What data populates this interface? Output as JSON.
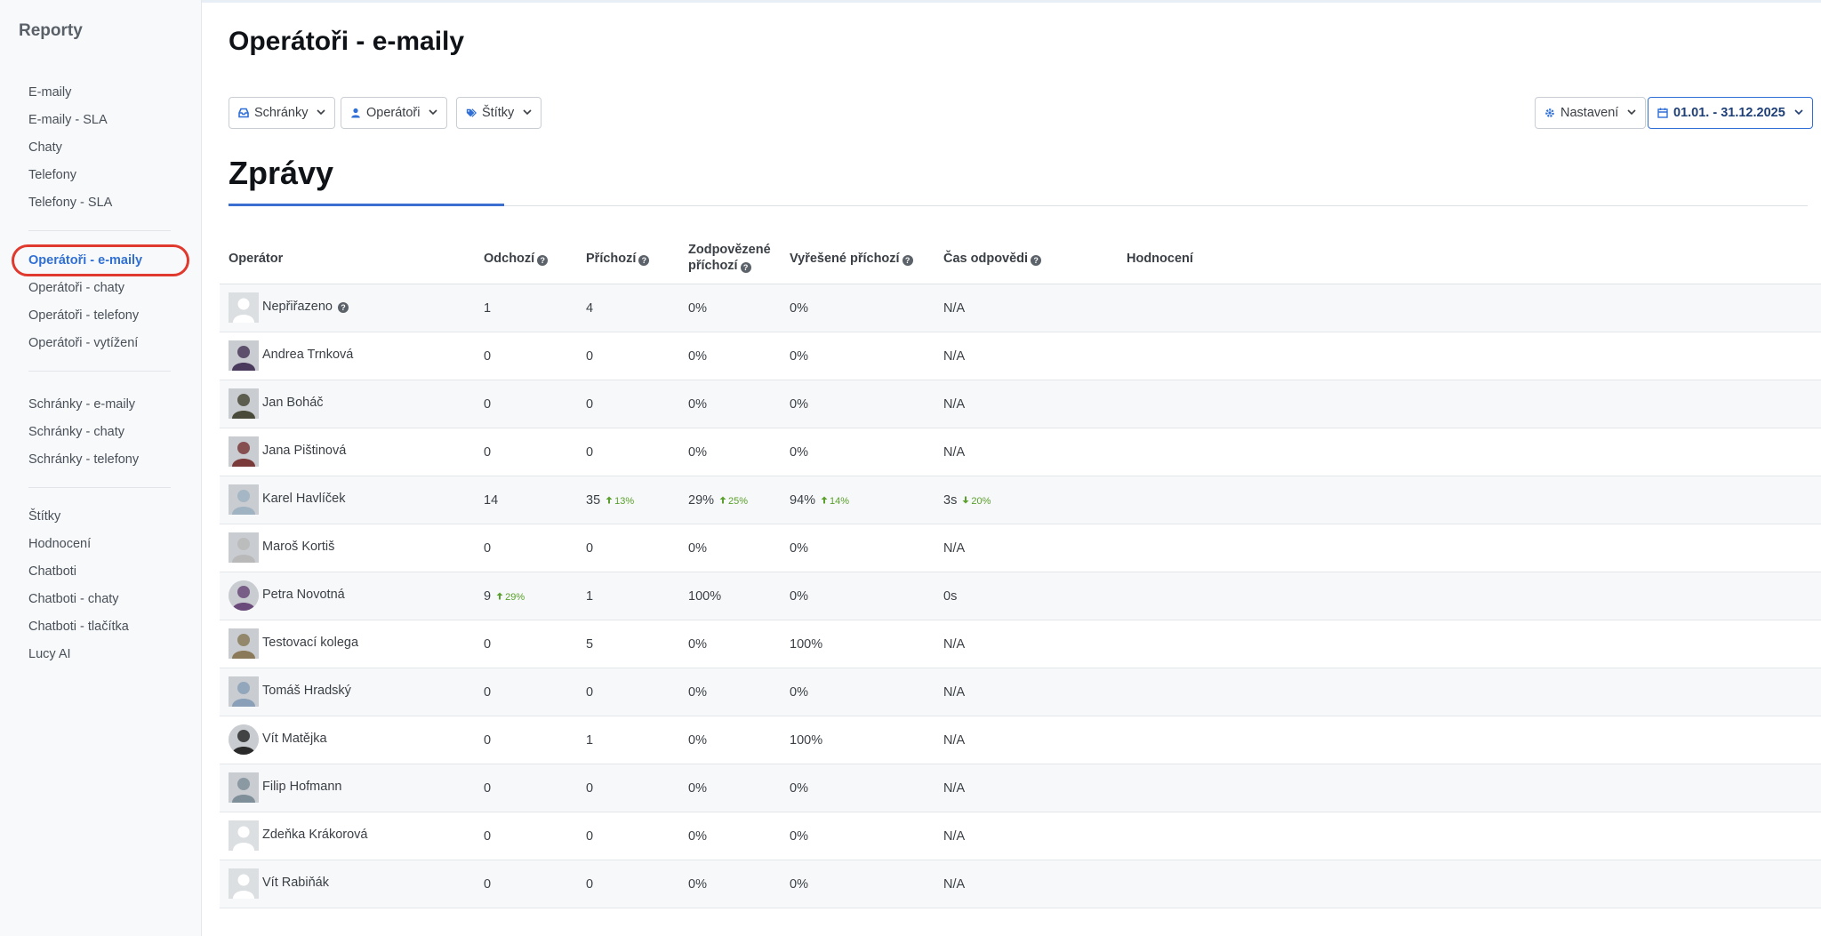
{
  "sidebar": {
    "title": "Reporty",
    "groups": [
      {
        "items": [
          {
            "label": "E-maily",
            "name": "sidebar-item-emails"
          },
          {
            "label": "E-maily - SLA",
            "name": "sidebar-item-emails-sla"
          },
          {
            "label": "Chaty",
            "name": "sidebar-item-chats"
          },
          {
            "label": "Telefony",
            "name": "sidebar-item-phones"
          },
          {
            "label": "Telefony - SLA",
            "name": "sidebar-item-phones-sla"
          }
        ]
      },
      {
        "items": [
          {
            "label": "Operátoři - e-maily",
            "name": "sidebar-item-operators-emails",
            "active": true
          },
          {
            "label": "Operátoři - chaty",
            "name": "sidebar-item-operators-chats"
          },
          {
            "label": "Operátoři - telefony",
            "name": "sidebar-item-operators-phones"
          },
          {
            "label": "Operátoři - vytížení",
            "name": "sidebar-item-operators-workload"
          }
        ]
      },
      {
        "items": [
          {
            "label": "Schránky - e-maily",
            "name": "sidebar-item-mailboxes-emails"
          },
          {
            "label": "Schránky - chaty",
            "name": "sidebar-item-mailboxes-chats"
          },
          {
            "label": "Schránky - telefony",
            "name": "sidebar-item-mailboxes-phones"
          }
        ]
      },
      {
        "items": [
          {
            "label": "Štítky",
            "name": "sidebar-item-tags"
          },
          {
            "label": "Hodnocení",
            "name": "sidebar-item-ratings"
          },
          {
            "label": "Chatboti",
            "name": "sidebar-item-chatbots"
          },
          {
            "label": "Chatboti - chaty",
            "name": "sidebar-item-chatbots-chats"
          },
          {
            "label": "Chatboti - tlačítka",
            "name": "sidebar-item-chatbots-buttons"
          },
          {
            "label": "Lucy AI",
            "name": "sidebar-item-lucy-ai"
          }
        ]
      }
    ]
  },
  "header": {
    "title": "Operátoři - e-maily"
  },
  "filters": {
    "mailboxes": "Schránky",
    "operators": "Operátoři",
    "tags": "Štítky",
    "settings": "Nastavení",
    "date_range": "01.01. - 31.12.2025"
  },
  "section": {
    "title": "Zprávy"
  },
  "table": {
    "headers": {
      "operator": "Operátor",
      "outgoing": "Odchozí",
      "incoming": "Příchozí",
      "answered_line1": "Zodpovězené",
      "answered_line2": "příchozí",
      "resolved": "Vyřešené příchozí",
      "response_time": "Čas odpovědi",
      "rating": "Hodnocení"
    },
    "rows": [
      {
        "name": "Nepřiřazeno",
        "info": true,
        "avatar": "placeholder",
        "outgoing": "1",
        "incoming": "4",
        "answered": "0%",
        "resolved": "0%",
        "response": "N/A"
      },
      {
        "name": "Andrea Trnková",
        "avatar": "photo",
        "avatar_color": "#4a3a5c",
        "outgoing": "0",
        "incoming": "0",
        "answered": "0%",
        "resolved": "0%",
        "response": "N/A"
      },
      {
        "name": "Jan Boháč",
        "avatar": "photo",
        "avatar_color": "#4a4a3a",
        "outgoing": "0",
        "incoming": "0",
        "answered": "0%",
        "resolved": "0%",
        "response": "N/A"
      },
      {
        "name": "Jana Pištinová",
        "avatar": "photo",
        "avatar_color": "#7a3a3a",
        "outgoing": "0",
        "incoming": "0",
        "answered": "0%",
        "resolved": "0%",
        "response": "N/A"
      },
      {
        "name": "Karel Havlíček",
        "avatar": "photo",
        "avatar_color": "#9fb3c2",
        "outgoing": "14",
        "incoming": "35",
        "incoming_trend": "13%",
        "answered": "29%",
        "answered_trend": "25%",
        "resolved": "94%",
        "resolved_trend": "14%",
        "response": "3s",
        "response_trend": "20%"
      },
      {
        "name": "Maroš Kortiš",
        "avatar": "photo",
        "avatar_color": "#b9b9b9",
        "outgoing": "0",
        "incoming": "0",
        "answered": "0%",
        "resolved": "0%",
        "response": "N/A"
      },
      {
        "name": "Petra Novotná",
        "avatar": "photo",
        "avatar_color": "#6a4a7a",
        "round": true,
        "outgoing": "9",
        "outgoing_trend": "29%",
        "incoming": "1",
        "answered": "100%",
        "resolved": "0%",
        "response": "0s"
      },
      {
        "name": "Testovací kolega",
        "avatar": "photo",
        "avatar_color": "#8a7a5a",
        "outgoing": "0",
        "incoming": "5",
        "answered": "0%",
        "resolved": "100%",
        "response": "N/A"
      },
      {
        "name": "Tomáš Hradský",
        "avatar": "photo",
        "avatar_color": "#8aa0b8",
        "outgoing": "0",
        "incoming": "0",
        "answered": "0%",
        "resolved": "0%",
        "response": "N/A"
      },
      {
        "name": "Vít Matějka",
        "avatar": "photo",
        "avatar_color": "#2a2a2a",
        "round": true,
        "outgoing": "0",
        "incoming": "1",
        "answered": "0%",
        "resolved": "100%",
        "response": "N/A"
      },
      {
        "name": "Filip Hofmann",
        "avatar": "photo",
        "avatar_color": "#7f8f9a",
        "outgoing": "0",
        "incoming": "0",
        "answered": "0%",
        "resolved": "0%",
        "response": "N/A"
      },
      {
        "name": "Zdeňka Krákorová",
        "avatar": "placeholder",
        "outgoing": "0",
        "incoming": "0",
        "answered": "0%",
        "resolved": "0%",
        "response": "N/A"
      },
      {
        "name": "Vít Rabiňák",
        "avatar": "placeholder",
        "outgoing": "0",
        "incoming": "0",
        "answered": "0%",
        "resolved": "0%",
        "response": "N/A"
      }
    ]
  },
  "colors": {
    "accent": "#2f6fd6",
    "trend_up": "#5aa02c",
    "highlight": "#e03a2f"
  }
}
